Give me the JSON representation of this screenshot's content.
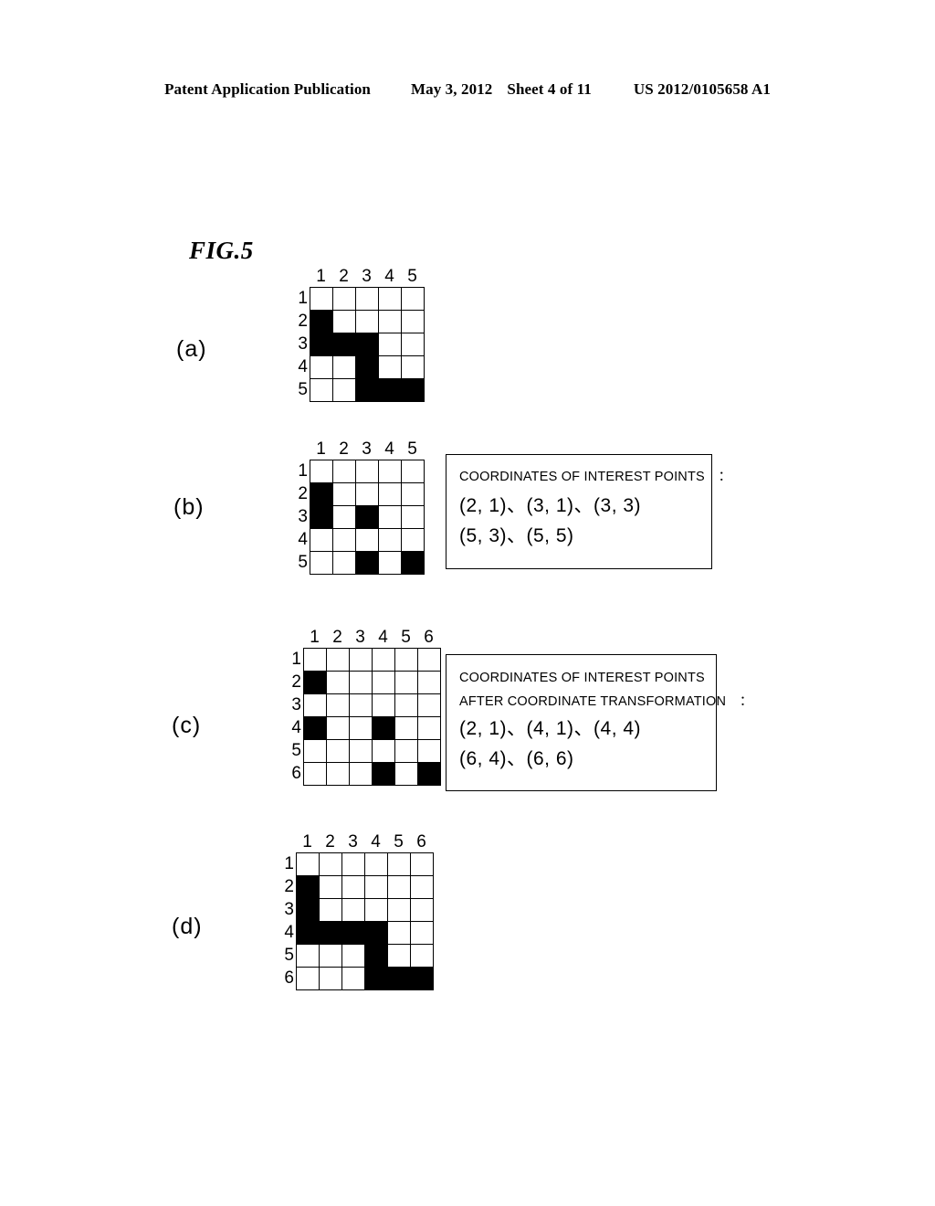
{
  "header": {
    "publication": "Patent Application Publication",
    "date": "May 3, 2012",
    "sheet": "Sheet 4 of 11",
    "number": "US 2012/0105658 A1"
  },
  "figure": {
    "title": "FIG.5"
  },
  "panels": [
    {
      "id": "a",
      "label": "(a)",
      "grid": {
        "cols": 5,
        "rows": 5,
        "col_headers": [
          "1",
          "2",
          "3",
          "4",
          "5"
        ],
        "row_headers": [
          "1",
          "2",
          "3",
          "4",
          "5"
        ],
        "filled_cells": [
          [
            2,
            1
          ],
          [
            3,
            1
          ],
          [
            3,
            2
          ],
          [
            3,
            3
          ],
          [
            4,
            3
          ],
          [
            5,
            3
          ],
          [
            5,
            4
          ],
          [
            5,
            5
          ]
        ]
      },
      "textbox": null
    },
    {
      "id": "b",
      "label": "(b)",
      "grid": {
        "cols": 5,
        "rows": 5,
        "col_headers": [
          "1",
          "2",
          "3",
          "4",
          "5"
        ],
        "row_headers": [
          "1",
          "2",
          "3",
          "4",
          "5"
        ],
        "filled_cells": [
          [
            2,
            1
          ],
          [
            3,
            1
          ],
          [
            3,
            3
          ],
          [
            5,
            3
          ],
          [
            5,
            5
          ]
        ]
      },
      "textbox": {
        "heading_lines": [
          "COORDINATES OF INTEREST POINTS　："
        ],
        "coordinate_lines": [
          "(2, 1)、(3, 1)、(3, 3)",
          "(5, 3)、(5, 5)"
        ]
      }
    },
    {
      "id": "c",
      "label": "(c)",
      "grid": {
        "cols": 6,
        "rows": 6,
        "col_headers": [
          "1",
          "2",
          "3",
          "4",
          "5",
          "6"
        ],
        "row_headers": [
          "1",
          "2",
          "3",
          "4",
          "5",
          "6"
        ],
        "filled_cells": [
          [
            2,
            1
          ],
          [
            4,
            1
          ],
          [
            4,
            4
          ],
          [
            6,
            4
          ],
          [
            6,
            6
          ]
        ]
      },
      "textbox": {
        "heading_lines": [
          "COORDINATES OF INTEREST POINTS",
          "AFTER COORDINATE TRANSFORMATION　："
        ],
        "coordinate_lines": [
          "(2, 1)、(4, 1)、(4, 4)",
          "(6, 4)、(6, 6)"
        ]
      }
    },
    {
      "id": "d",
      "label": "(d)",
      "grid": {
        "cols": 6,
        "rows": 6,
        "col_headers": [
          "1",
          "2",
          "3",
          "4",
          "5",
          "6"
        ],
        "row_headers": [
          "1",
          "2",
          "3",
          "4",
          "5",
          "6"
        ],
        "filled_cells": [
          [
            2,
            1
          ],
          [
            3,
            1
          ],
          [
            4,
            1
          ],
          [
            4,
            2
          ],
          [
            4,
            3
          ],
          [
            4,
            4
          ],
          [
            5,
            4
          ],
          [
            6,
            4
          ],
          [
            6,
            5
          ],
          [
            6,
            6
          ]
        ]
      },
      "textbox": null
    }
  ],
  "colors": {
    "ink": "#000000",
    "paper": "#ffffff"
  }
}
